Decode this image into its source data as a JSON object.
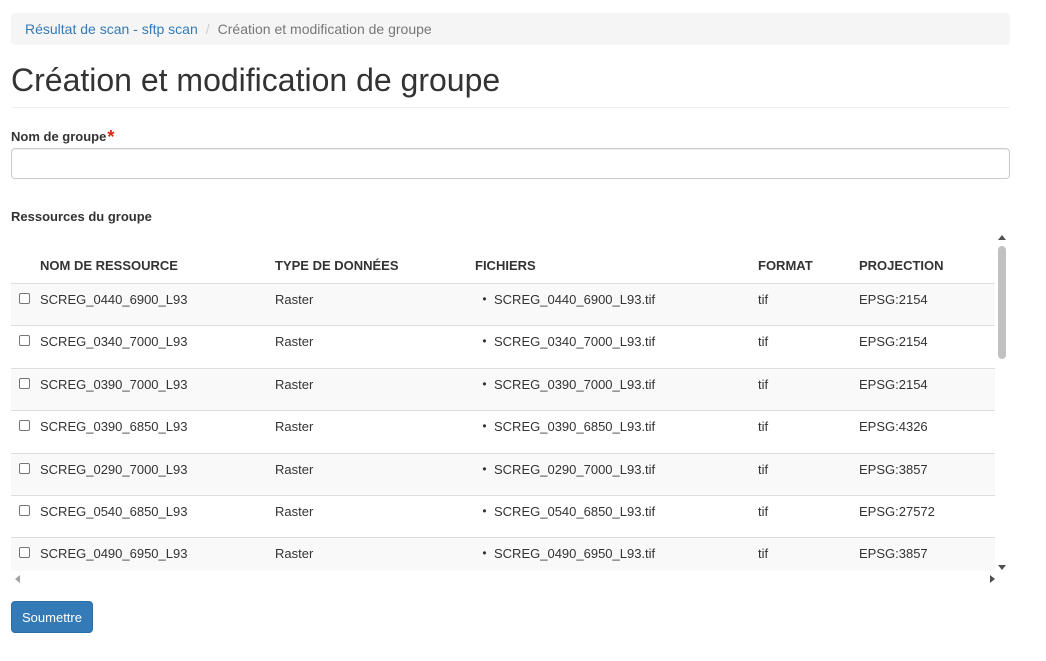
{
  "breadcrumb": {
    "parent": "Résultat de scan - sftp scan",
    "separator": "/",
    "current": "Création et modification de groupe"
  },
  "page": {
    "title": "Création et modification de groupe"
  },
  "form": {
    "group_name_label": "Nom de groupe",
    "required_marker": "*",
    "group_name_value": "",
    "resources_label": "Ressources du groupe",
    "submit_label": "Soumettre"
  },
  "table": {
    "columns": [
      "NOM DE RESSOURCE",
      "TYPE DE DONNÉES",
      "FICHIERS",
      "FORMAT",
      "PROJECTION"
    ],
    "rows": [
      {
        "name": "SCREG_0440_6900_L93",
        "type": "Raster",
        "file": "SCREG_0440_6900_L93.tif",
        "format": "tif",
        "projection": "EPSG:2154",
        "checked": false
      },
      {
        "name": "SCREG_0340_7000_L93",
        "type": "Raster",
        "file": "SCREG_0340_7000_L93.tif",
        "format": "tif",
        "projection": "EPSG:2154",
        "checked": false
      },
      {
        "name": "SCREG_0390_7000_L93",
        "type": "Raster",
        "file": "SCREG_0390_7000_L93.tif",
        "format": "tif",
        "projection": "EPSG:2154",
        "checked": false
      },
      {
        "name": "SCREG_0390_6850_L93",
        "type": "Raster",
        "file": "SCREG_0390_6850_L93.tif",
        "format": "tif",
        "projection": "EPSG:4326",
        "checked": false
      },
      {
        "name": "SCREG_0290_7000_L93",
        "type": "Raster",
        "file": "SCREG_0290_7000_L93.tif",
        "format": "tif",
        "projection": "EPSG:3857",
        "checked": false
      },
      {
        "name": "SCREG_0540_6850_L93",
        "type": "Raster",
        "file": "SCREG_0540_6850_L93.tif",
        "format": "tif",
        "projection": "EPSG:27572",
        "checked": false
      },
      {
        "name": "SCREG_0490_6950_L93",
        "type": "Raster",
        "file": "SCREG_0490_6950_L93.tif",
        "format": "tif",
        "projection": "EPSG:3857",
        "checked": false
      }
    ]
  },
  "colors": {
    "link": "#337ab7",
    "primary": "#337ab7",
    "required": "#d9230f",
    "breadcrumb_bg": "#f5f5f5",
    "row_stripe": "#f9f9f9"
  }
}
